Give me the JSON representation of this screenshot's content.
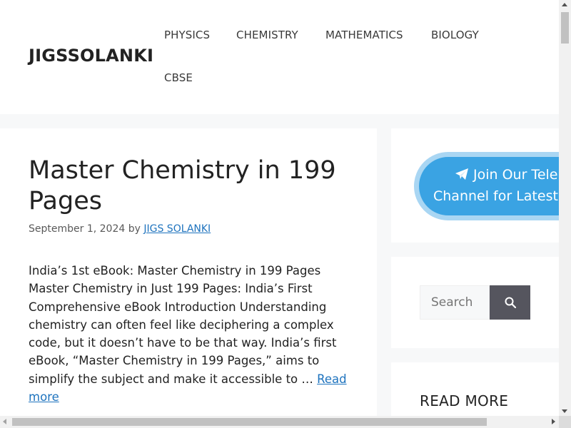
{
  "site": {
    "title": "JIGSSOLANKI"
  },
  "nav": {
    "items": [
      {
        "label": "PHYSICS"
      },
      {
        "label": "CHEMISTRY"
      },
      {
        "label": "MATHEMATICS"
      },
      {
        "label": "BIOLOGY"
      },
      {
        "label": "CBSE"
      }
    ]
  },
  "post": {
    "title": "Master Chemistry in 199 Pages",
    "date": "September 1, 2024",
    "by": "by",
    "author": "JIGS SOLANKI",
    "excerpt": "India’s 1st eBook: Master Chemistry in 199 Pages Master Chemistry in Just 199 Pages: India’s First Comprehensive eBook Introduction Understanding chemistry can often feel like deciphering a complex code, but it doesn’t have to be that way. India’s first eBook, “Master Chemistry in 199 Pages,” aims to simplify the subject and make it accessible to …",
    "read_more": "Read more"
  },
  "sidebar": {
    "telegram": {
      "line1": "Join Our Tele",
      "line2": "Channel for Latest",
      "icon": "telegram-plane-icon"
    },
    "search": {
      "placeholder": "Search",
      "button_icon": "search-icon"
    },
    "read_more_title": "READ MORE"
  },
  "colors": {
    "link": "#1e73be",
    "telegram": "#3aa3e3",
    "search_button": "#55555e",
    "background": "#f7f8f9"
  }
}
